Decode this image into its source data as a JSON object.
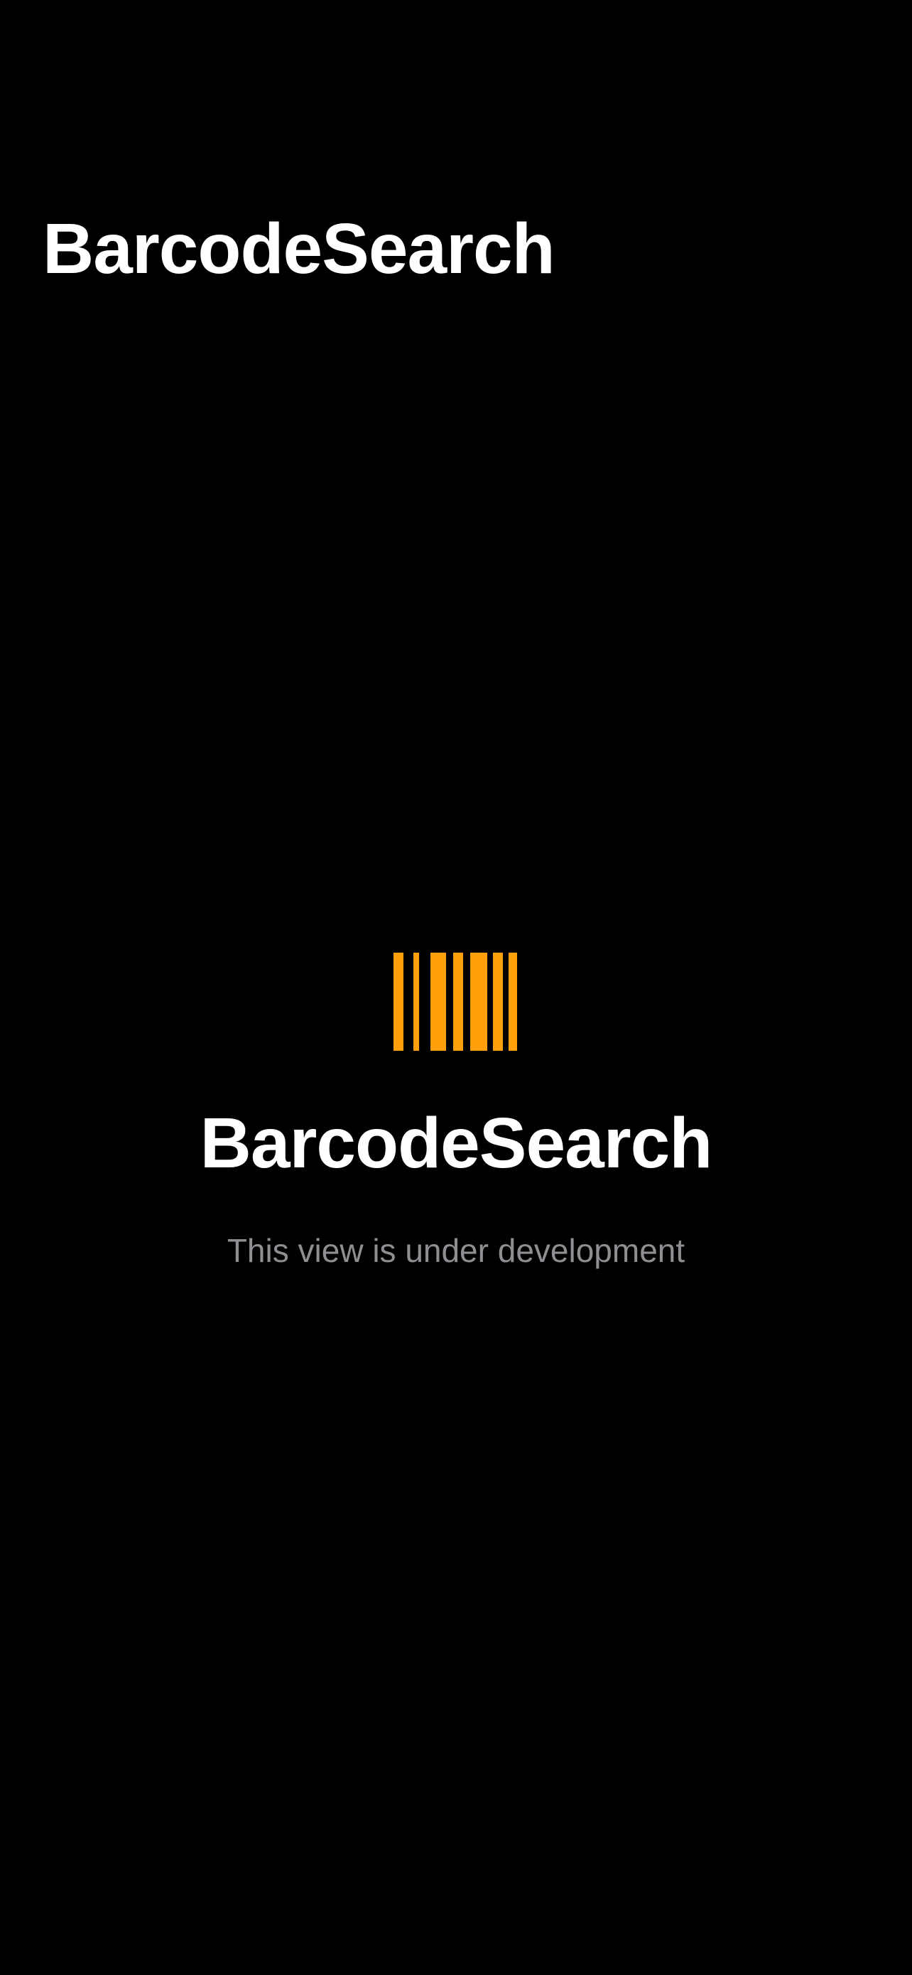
{
  "navigation": {
    "title": "BarcodeSearch"
  },
  "placeholder": {
    "icon": "barcode-icon",
    "icon_color": "#FF9F0A",
    "title": "BarcodeSearch",
    "subtitle": "This view is under development"
  },
  "colors": {
    "background": "#000000",
    "primary_text": "#FFFFFF",
    "secondary_text": "#8E8E93",
    "accent": "#FF9F0A"
  }
}
